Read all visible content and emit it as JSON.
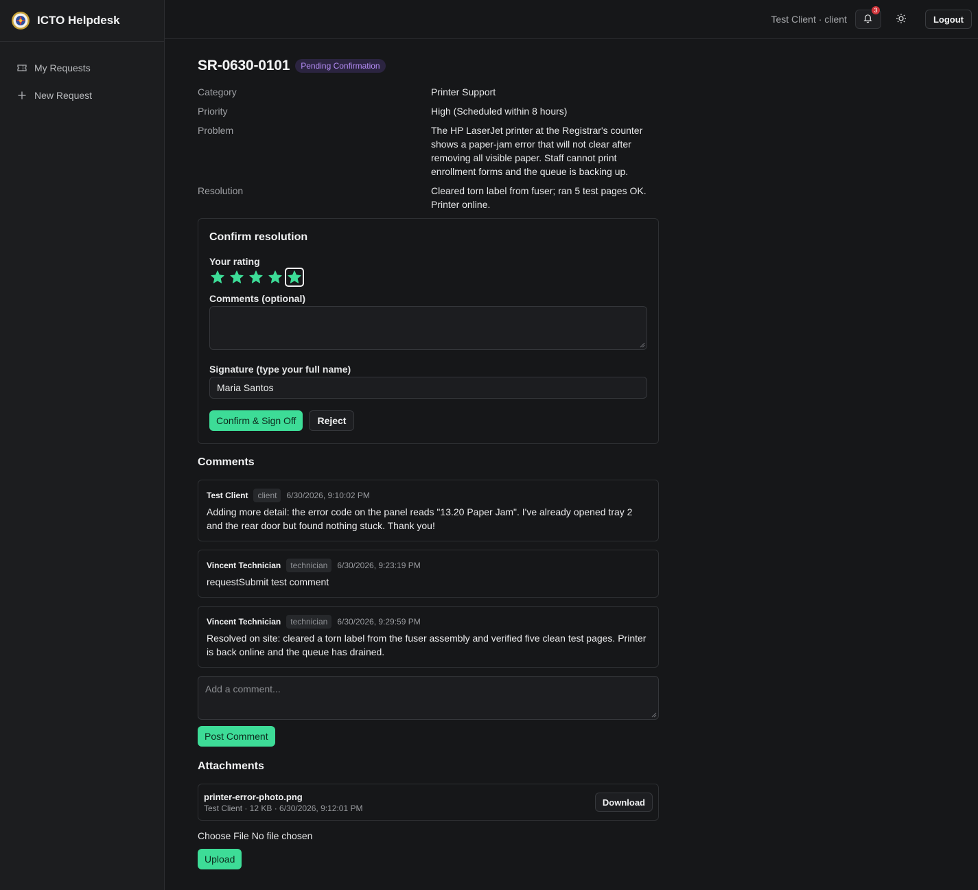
{
  "app": {
    "name": "ICTO Helpdesk",
    "logo_icon": "seal-logo-icon"
  },
  "sidebar": {
    "items": [
      {
        "label": "My Requests",
        "icon": "ticket-icon"
      },
      {
        "label": "New Request",
        "icon": "plus-icon"
      }
    ]
  },
  "header": {
    "user_label": "Test Client · client",
    "notification_count": "3",
    "logout_label": "Logout"
  },
  "ticket": {
    "id": "SR-0630-0101",
    "status": "Pending Confirmation",
    "details": [
      {
        "label": "Category",
        "value": "Printer Support"
      },
      {
        "label": "Priority",
        "value": "High (Scheduled within 8 hours)"
      },
      {
        "label": "Problem",
        "value": "The HP LaserJet printer at the Registrar's counter shows a paper-jam error that will not clear after removing all visible paper. Staff cannot print enrollment forms and the queue is backing up."
      },
      {
        "label": "Resolution",
        "value": "Cleared torn label from fuser; ran 5 test pages OK. Printer online."
      }
    ]
  },
  "confirm": {
    "title": "Confirm resolution",
    "rating_label": "Your rating",
    "rating": 5,
    "rating_max": 5,
    "comments_label": "Comments (optional)",
    "comments_value": "",
    "signature_label": "Signature (type your full name)",
    "signature_value": "Maria Santos",
    "confirm_button": "Confirm & Sign Off",
    "reject_button": "Reject"
  },
  "comments": {
    "title": "Comments",
    "items": [
      {
        "author": "Test Client",
        "role": "client",
        "time": "6/30/2026, 9:10:02 PM",
        "body": "Adding more detail: the error code on the panel reads \"13.20 Paper Jam\". I've already opened tray 2 and the rear door but found nothing stuck. Thank you!"
      },
      {
        "author": "Vincent Technician",
        "role": "technician",
        "time": "6/30/2026, 9:23:19 PM",
        "body": "requestSubmit test comment"
      },
      {
        "author": "Vincent Technician",
        "role": "technician",
        "time": "6/30/2026, 9:29:59 PM",
        "body": "Resolved on site: cleared a torn label from the fuser assembly and verified five clean test pages. Printer is back online and the queue has drained."
      }
    ],
    "add_placeholder": "Add a comment...",
    "post_button": "Post Comment"
  },
  "attachments": {
    "title": "Attachments",
    "items": [
      {
        "name": "printer-error-photo.png",
        "meta": "Test Client · 12 KB · 6/30/2026, 9:12:01 PM",
        "download_label": "Download"
      }
    ],
    "choose_file_label": "Choose File",
    "no_file_label": "No file chosen",
    "upload_button": "Upload"
  },
  "colors": {
    "accent": "#3ddc97",
    "status_purple": "#b48cf5",
    "background": "#161719",
    "sidebar": "#1c1d1f"
  }
}
